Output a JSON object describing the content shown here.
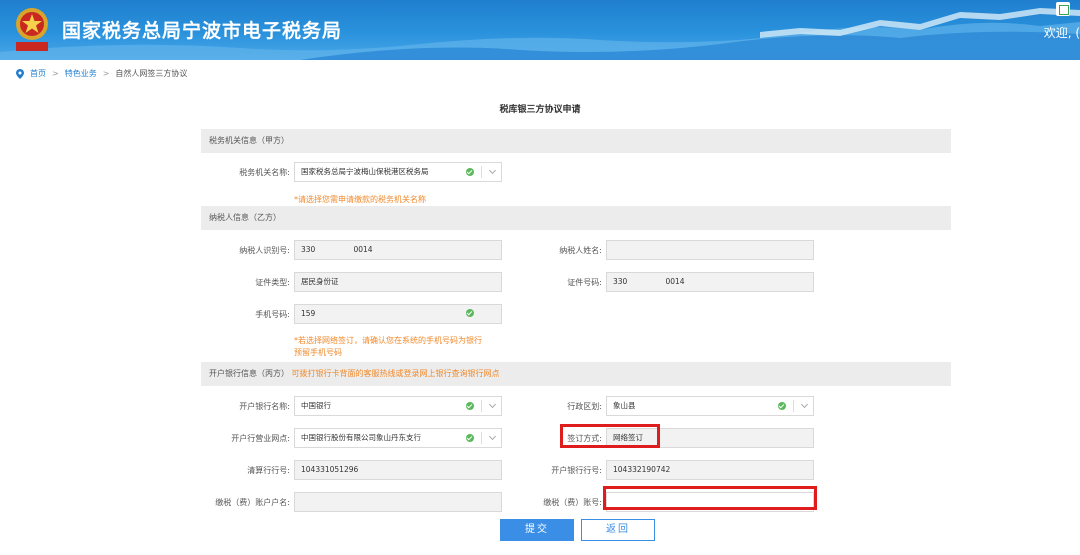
{
  "header": {
    "site_title": "国家税务总局宁波市电子税务局",
    "welcome": "欢迎, (",
    "emblem_text": "中国税务"
  },
  "breadcrumb": {
    "home": "首页",
    "section": "特色业务",
    "current": "自然人网签三方协议",
    "separator": ">"
  },
  "form": {
    "title": "税库银三方协议申请",
    "sections": {
      "tax_authority": "税务机关信息（甲方）",
      "taxpayer": "纳税人信息（乙方）",
      "bank": "开户银行信息（丙方）",
      "bank_note": "可拨打银行卡背面的客服热线或登录网上银行查询银行网点"
    },
    "tax_authority": {
      "label": "税务机关名称:",
      "value": "国家税务总局宁波梅山保税港区税务局",
      "hint": "*请选择您需申请缴款的税务机关名称"
    },
    "taxpayer": {
      "id_label": "纳税人识别号:",
      "id_value": "330                0014",
      "name_label": "纳税人姓名:",
      "name_value": "",
      "cert_type_label": "证件类型:",
      "cert_type_value": "居民身份证",
      "cert_no_label": "证件号码:",
      "cert_no_value": "330                0014",
      "phone_label": "手机号码:",
      "phone_value": "159",
      "phone_hint_1": "*若选择网络签订，请确认您在系统的手机号码为银行",
      "phone_hint_2": "预留手机号码"
    },
    "bank": {
      "bank_name_label": "开户银行名称:",
      "bank_name_value": "中国银行",
      "district_label": "行政区划:",
      "district_value": "象山县",
      "branch_label": "开户行营业网点:",
      "branch_value": "中国银行股份有限公司象山丹东支行",
      "sign_label": "签订方式:",
      "sign_value": "网络签订",
      "clearing_label": "清算行行号:",
      "clearing_value": "104331051296",
      "bank_no_label": "开户银行行号:",
      "bank_no_value": "104332190742",
      "account_name_label": "缴税（费）账户户名:",
      "account_name_value": "",
      "account_no_label": "缴税（费）账号:",
      "account_no_value": ""
    },
    "buttons": {
      "submit": "提交",
      "back": "返回"
    }
  },
  "colors": {
    "header_blue": "#1f7fce",
    "accent": "#3a8ee6",
    "hint_orange": "#f08a2c",
    "highlight_red": "#e01d1d",
    "valid_green": "#5cb85c"
  }
}
